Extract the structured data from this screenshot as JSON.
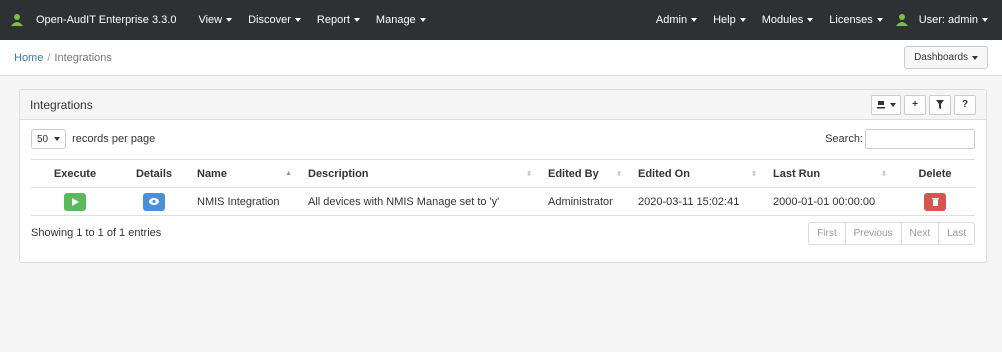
{
  "navbar": {
    "brand": "Open-AudIT Enterprise 3.3.0",
    "left_menu": [
      "View",
      "Discover",
      "Report",
      "Manage"
    ],
    "right_menu": [
      "Admin",
      "Help",
      "Modules",
      "Licenses"
    ],
    "user": "User: admin"
  },
  "breadcrumb": {
    "home": "Home",
    "separator": "/",
    "current": "Integrations"
  },
  "dashboards_label": "Dashboards",
  "panel": {
    "title": "Integrations",
    "tools": {
      "add": "+",
      "help": "?"
    }
  },
  "controls": {
    "page_length": "50",
    "records_label": "records per page",
    "search_label": "Search:",
    "search_value": ""
  },
  "table": {
    "columns": [
      "Execute",
      "Details",
      "Name",
      "Description",
      "Edited By",
      "Edited On",
      "Last Run",
      "Delete"
    ],
    "rows": [
      {
        "name": "NMIS Integration",
        "description": "All devices with NMIS Manage set to 'y'",
        "edited_by": "Administrator",
        "edited_on": "2020-03-11 15:02:41",
        "last_run": "2000-01-01 00:00:00"
      }
    ]
  },
  "footer": {
    "info": "Showing 1 to 1 of 1 entries",
    "pager": [
      "First",
      "Previous",
      "Next",
      "Last"
    ]
  },
  "colors": {
    "navbar": "#2d3134",
    "execute": "#5cb85c",
    "details": "#4a90d9",
    "delete": "#d9534f",
    "link": "#337ab7"
  }
}
